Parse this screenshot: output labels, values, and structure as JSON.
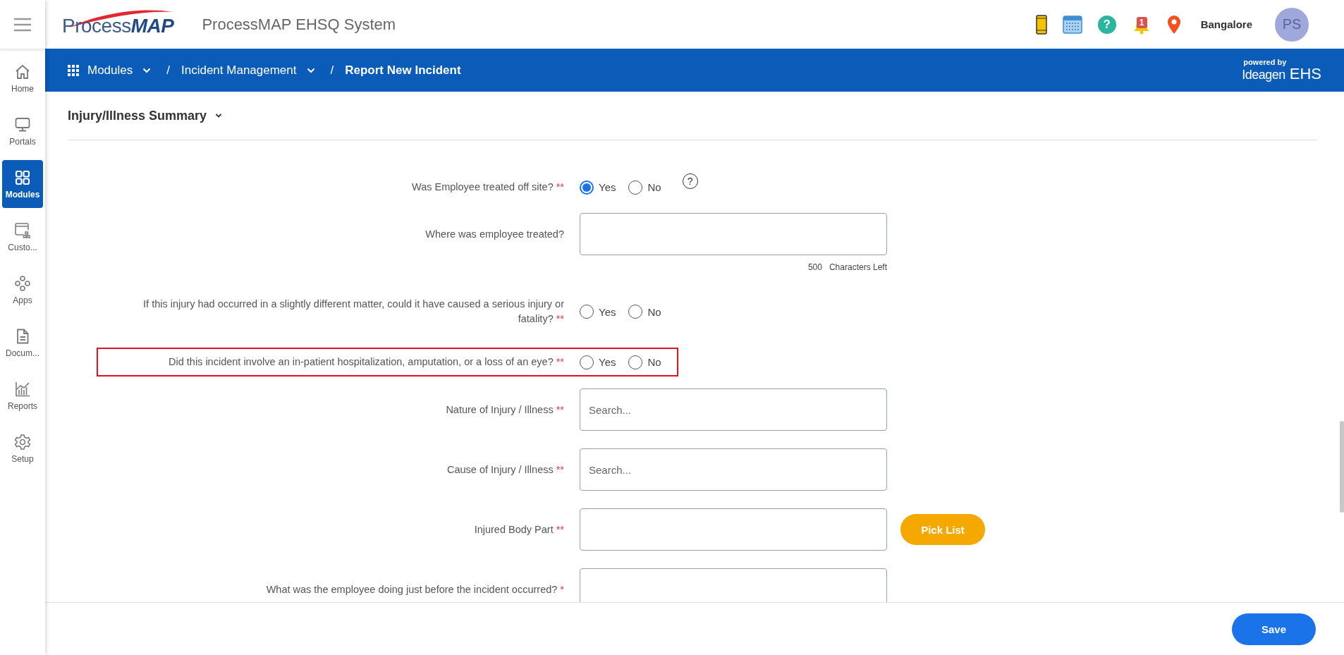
{
  "app": {
    "logo": "Process**MAP**",
    "title": "ProcessMAP EHSQ System",
    "help": "?",
    "notification_count": "1",
    "location": "Bangalore",
    "avatar_initials": "PS"
  },
  "sidebar": {
    "items": [
      {
        "label": "Home",
        "selected": false
      },
      {
        "label": "Portals",
        "selected": false
      },
      {
        "label": "Modules",
        "selected": true
      },
      {
        "label": "Custo...",
        "selected": false
      },
      {
        "label": "Apps",
        "selected": false
      },
      {
        "label": "Docum...",
        "selected": false
      },
      {
        "label": "Reports",
        "selected": false
      },
      {
        "label": "Setup",
        "selected": false
      }
    ]
  },
  "breadcrumb": [
    {
      "label": "Modules",
      "dropdown": true,
      "current": false
    },
    {
      "separator": "/",
      "label": "Incident Management",
      "dropdown": true,
      "current": false
    },
    {
      "separator": "/",
      "label": "Report New Incident",
      "dropdown": false,
      "current": true
    }
  ],
  "powered_by": {
    "caption": "powered by",
    "brand": "Ideagen",
    "product": "EHS"
  },
  "section": {
    "title": "Injury/Illness Summary",
    "expanded": true
  },
  "fields": [
    {
      "kind": "radio",
      "label": "Was Employee treated off site?",
      "required": "**",
      "highlighted": false,
      "help": "?",
      "options": [
        {
          "label": "Yes",
          "selected": true
        },
        {
          "label": "No",
          "selected": false
        }
      ]
    },
    {
      "kind": "textarea",
      "label": "Where was employee treated?",
      "highlighted": false,
      "counter": "500",
      "counter_label": "Characters Left"
    },
    {
      "kind": "radio",
      "label": "If this injury had occurred in a slightly different matter, could it have caused a serious injury or fatality?",
      "required": "**",
      "highlighted": false,
      "options": [
        {
          "label": "Yes",
          "selected": false
        },
        {
          "label": "No",
          "selected": false
        }
      ]
    },
    {
      "kind": "radio",
      "label": "Did this incident involve an in-patient hospitalization, amputation, or a loss of an eye?",
      "required": "**",
      "highlighted": true,
      "options": [
        {
          "label": "Yes",
          "selected": false
        },
        {
          "label": "No",
          "selected": false
        }
      ]
    },
    {
      "kind": "search",
      "label": "Nature of Injury / Illness",
      "required": "**",
      "highlighted": false,
      "placeholder": "Search..."
    },
    {
      "kind": "search",
      "label": "Cause of Injury / Illness",
      "required": "**",
      "highlighted": false,
      "placeholder": "Search..."
    },
    {
      "kind": "picklist",
      "label": "Injured Body Part",
      "required": "**",
      "highlighted": false,
      "button": "Pick List"
    },
    {
      "kind": "textarea",
      "label": "What was the employee doing just before the incident occurred?",
      "required": "*",
      "highlighted": false
    }
  ],
  "footer": {
    "save": "Save"
  }
}
